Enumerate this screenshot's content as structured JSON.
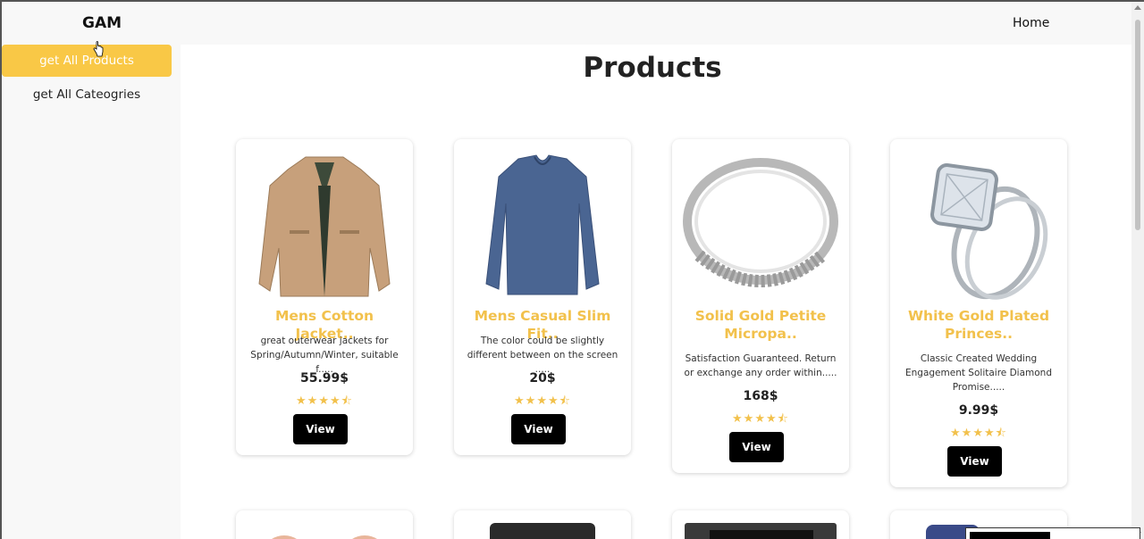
{
  "header": {
    "brand": "GAM",
    "home_link": "Home"
  },
  "sidebar": {
    "items": [
      {
        "label": "get All Products",
        "active": true
      },
      {
        "label": "get All Cateogries",
        "active": false
      }
    ]
  },
  "main": {
    "title": "Products",
    "products": [
      {
        "title": "Mens Cotton Jacket..",
        "description": "great outerwear jackets for Spring/Autumn/Winter, suitable f.....",
        "price": "55.99$",
        "stars": "★★★★⯪",
        "button": "View",
        "image": "jacket-image"
      },
      {
        "title": "Mens Casual Slim Fit..",
        "description": "The color could be slightly different between on the screen .....",
        "price": "20$",
        "stars": "★★★★⯪",
        "button": "View",
        "image": "long-sleeve-shirt-image"
      },
      {
        "title": "Solid Gold Petite Micropa..",
        "description": "Satisfaction Guaranteed. Return or exchange any order within.....",
        "price": "168$",
        "stars": "★★★★⯪",
        "button": "View",
        "image": "silver-ring-image"
      },
      {
        "title": "White Gold Plated Princes..",
        "description": "Classic Created Wedding Engagement Solitaire Diamond Promise.....",
        "price": "9.99$",
        "stars": "★★★★⯪",
        "button": "View",
        "image": "diamond-ring-image"
      }
    ]
  },
  "colors": {
    "accent": "#f9c846",
    "title_yellow": "#f2c14c",
    "button_bg": "#000000"
  }
}
